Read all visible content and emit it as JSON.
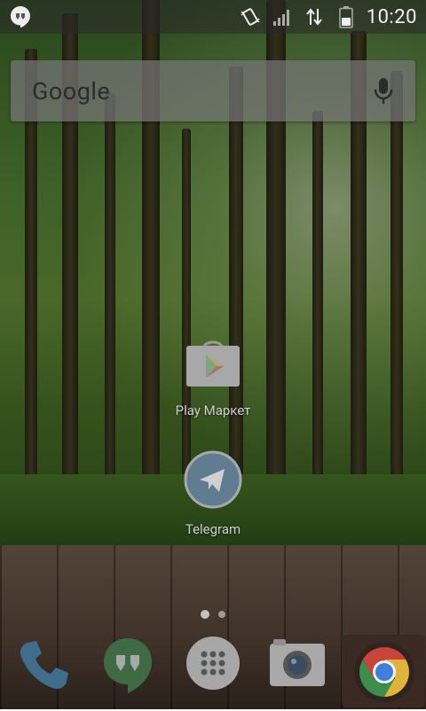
{
  "status_bar": {
    "time": "10:20",
    "icons": [
      "hangouts-notification-icon",
      "vibrate-icon",
      "signal-icon",
      "data-transfer-icon",
      "battery-icon"
    ]
  },
  "search_bar": {
    "logo_text": "Google",
    "mic": "microphone-icon"
  },
  "apps": [
    {
      "label": "Play Маркет",
      "icon": "play-market-icon"
    },
    {
      "label": "Telegram",
      "icon": "telegram-icon"
    }
  ],
  "page_indicator": {
    "pages": 2,
    "current": 1
  },
  "dock": [
    {
      "icon": "phone-icon"
    },
    {
      "icon": "hangouts-icon"
    },
    {
      "icon": "app-drawer-icon"
    },
    {
      "icon": "camera-icon"
    },
    {
      "icon": "chrome-icon"
    }
  ]
}
